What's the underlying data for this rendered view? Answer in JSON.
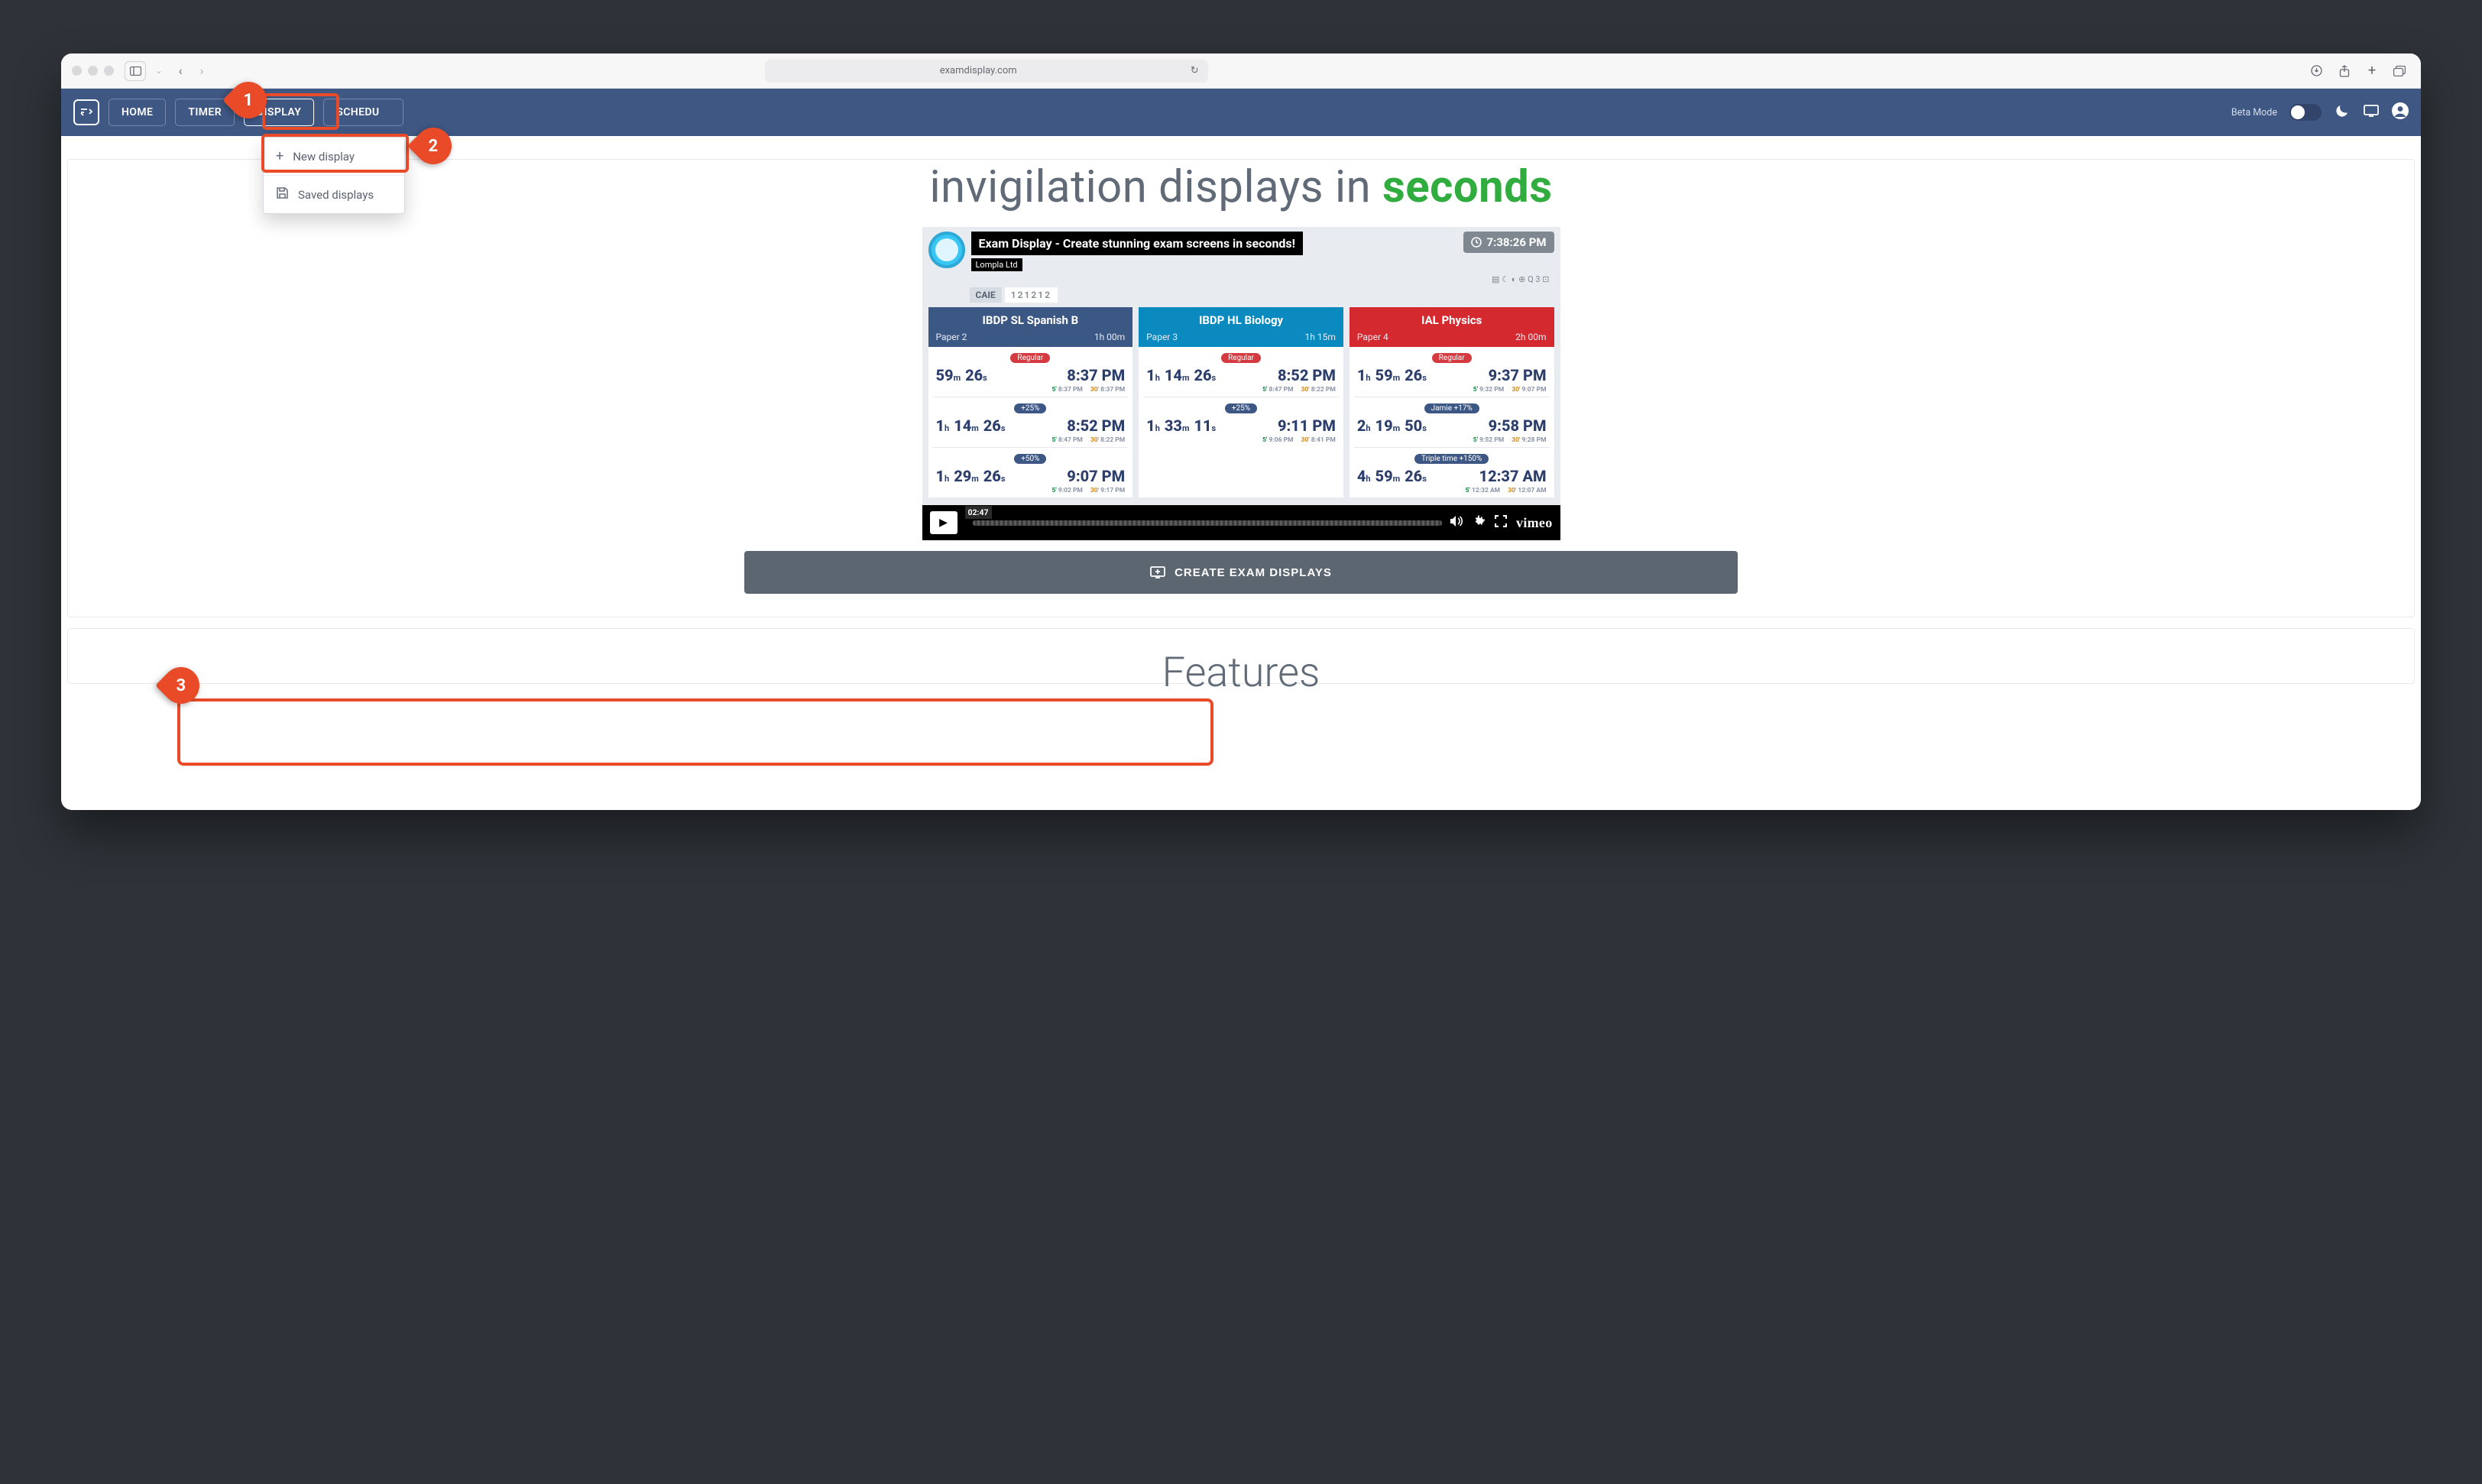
{
  "addressbar": {
    "domain": "examdisplay.com"
  },
  "nav": {
    "home": "HOME",
    "timer": "TIMER",
    "display": "DISPLAY",
    "schedule": "SCHEDU",
    "beta": "Beta Mode"
  },
  "dropdown": {
    "new": "New display",
    "saved": "Saved displays"
  },
  "hero": {
    "lead": "invigilation displays in",
    "accent": "seconds"
  },
  "video": {
    "title": "Exam Display - Create stunning exam screens in seconds!",
    "subtitle": "Lompla Ltd",
    "clock": "7:38:26 PM",
    "chips": {
      "caie": "CAIE",
      "code": "121212"
    },
    "timecode": "02:47",
    "brand": "vimeo"
  },
  "cards": [
    {
      "color": "blue",
      "title": "IBDP SL Spanish B",
      "paper": "Paper 2",
      "duration": "1h 00m",
      "rows": [
        {
          "pill": "Regular",
          "pillColor": "red",
          "time": "59m 26s",
          "end": "8:37 PM",
          "s": "8:37 PM",
          "a": "8:37 PM"
        },
        {
          "pill": "+25%",
          "pillColor": "blue",
          "time": "1h 14m 26s",
          "end": "8:52 PM",
          "s": "8:47 PM",
          "a": "8:22 PM"
        },
        {
          "pill": "+50%",
          "pillColor": "blue",
          "time": "1h 29m 26s",
          "end": "9:07 PM",
          "s": "9:02 PM",
          "a": "9:17 PM"
        }
      ]
    },
    {
      "color": "teal",
      "title": "IBDP HL Biology",
      "paper": "Paper 3",
      "duration": "1h 15m",
      "rows": [
        {
          "pill": "Regular",
          "pillColor": "red",
          "time": "1h 14m 26s",
          "end": "8:52 PM",
          "s": "8:47 PM",
          "a": "8:22 PM"
        },
        {
          "pill": "+25%",
          "pillColor": "blue",
          "time": "1h 33m 11s",
          "end": "9:11 PM",
          "s": "9:06 PM",
          "a": "8:41 PM"
        }
      ]
    },
    {
      "color": "red",
      "title": "IAL Physics",
      "paper": "Paper 4",
      "duration": "2h 00m",
      "rows": [
        {
          "pill": "Regular",
          "pillColor": "red",
          "time": "1h 59m 26s",
          "end": "9:37 PM",
          "s": "9:32 PM",
          "a": "9:07 PM"
        },
        {
          "pill": "Jamie +17%",
          "pillColor": "blue",
          "time": "2h 19m 50s",
          "end": "9:58 PM",
          "s": "9:52 PM",
          "a": "9:28 PM"
        },
        {
          "pill": "Triple time +150%",
          "pillColor": "blue",
          "time": "4h 59m 26s",
          "end": "12:37 AM",
          "s": "12:32 AM",
          "a": "12:07 AM"
        }
      ]
    }
  ],
  "cta": {
    "label": "CREATE EXAM DISPLAYS"
  },
  "features": {
    "heading": "Features"
  },
  "markers": {
    "m1": "1",
    "m2": "2",
    "m3": "3"
  }
}
